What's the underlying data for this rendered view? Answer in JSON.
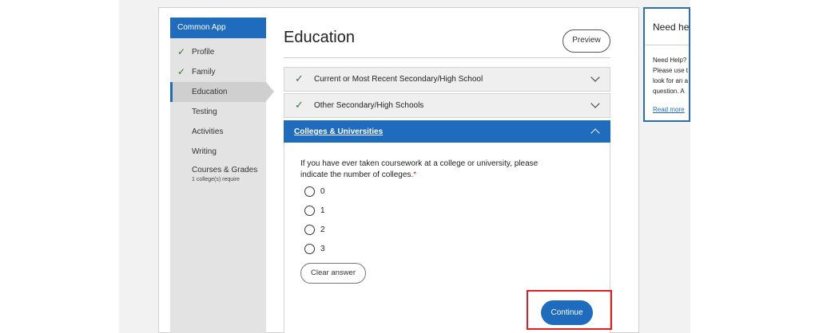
{
  "sidebar": {
    "header": "Common App",
    "items": [
      {
        "label": "Profile",
        "completed": true
      },
      {
        "label": "Family",
        "completed": true
      },
      {
        "label": "Education",
        "active": true
      },
      {
        "label": "Testing"
      },
      {
        "label": "Activities"
      },
      {
        "label": "Writing"
      },
      {
        "label": "Courses & Grades",
        "sub": "1 college(s) require"
      }
    ]
  },
  "main": {
    "title": "Education",
    "preview_label": "Preview",
    "sections": [
      {
        "label": "Current or Most Recent Secondary/High School",
        "completed": true
      },
      {
        "label": "Other Secondary/High Schools",
        "completed": true
      },
      {
        "label": "Colleges & Universities",
        "expanded": true
      }
    ],
    "question": {
      "text": "If you have ever taken coursework at a college or university, please indicate the number of colleges.",
      "required_mark": "*",
      "options": [
        "0",
        "1",
        "2",
        "3"
      ]
    },
    "clear_label": "Clear answer",
    "continue_label": "Continue"
  },
  "help": {
    "title": "Need he",
    "subtitle": "Need Help?",
    "lines": [
      "Please use t",
      "look for an a",
      "question. A"
    ],
    "read_more": "Read more"
  },
  "colors": {
    "accent": "#1f6bbd",
    "check": "#2e7d32",
    "highlight": "#e02020"
  },
  "icons": {
    "completed": "check-icon",
    "collapsed": "chevron-down-icon",
    "expanded": "chevron-up-icon"
  }
}
